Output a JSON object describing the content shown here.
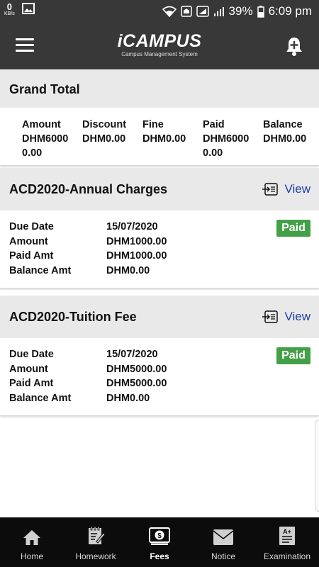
{
  "status_bar": {
    "speed_value": "0",
    "speed_unit": "KB/s",
    "battery": "39%",
    "time": "6:09 pm"
  },
  "app_bar": {
    "logo_text": "iCAMPUS",
    "logo_subtitle": "Campus Management System"
  },
  "grand_total": {
    "title": "Grand Total",
    "columns": [
      {
        "label": "Amount",
        "value": "DHM60000.00"
      },
      {
        "label": "Discount",
        "value": "DHM0.00"
      },
      {
        "label": "Fine",
        "value": "DHM0.00"
      },
      {
        "label": "Paid",
        "value": "DHM60000.00"
      },
      {
        "label": "Balance",
        "value": "DHM0.00"
      }
    ]
  },
  "fees": [
    {
      "title": "ACD2020-Annual Charges",
      "view_label": "View",
      "status": "Paid",
      "rows": [
        {
          "key": "Due Date",
          "value": "15/07/2020"
        },
        {
          "key": "Amount",
          "value": "DHM1000.00"
        },
        {
          "key": "Paid Amt",
          "value": "DHM1000.00"
        },
        {
          "key": "Balance Amt",
          "value": "DHM0.00"
        }
      ]
    },
    {
      "title": "ACD2020-Tuition Fee",
      "view_label": "View",
      "status": "Paid",
      "rows": [
        {
          "key": "Due Date",
          "value": "15/07/2020"
        },
        {
          "key": "Amount",
          "value": "DHM5000.00"
        },
        {
          "key": "Paid Amt",
          "value": "DHM5000.00"
        },
        {
          "key": "Balance Amt",
          "value": "DHM0.00"
        }
      ]
    }
  ],
  "bottom_nav": {
    "items": [
      {
        "label": "Home",
        "icon": "home-icon"
      },
      {
        "label": "Homework",
        "icon": "homework-icon"
      },
      {
        "label": "Fees",
        "icon": "fees-icon",
        "active": true
      },
      {
        "label": "Notice",
        "icon": "notice-icon"
      },
      {
        "label": "Examination",
        "icon": "examination-icon"
      }
    ]
  },
  "colors": {
    "app_bar": "#383838",
    "section_header": "#e9e9e9",
    "paid_badge": "#43a047",
    "link": "#1a3fa8",
    "bottom_nav": "#0c0c0c"
  }
}
